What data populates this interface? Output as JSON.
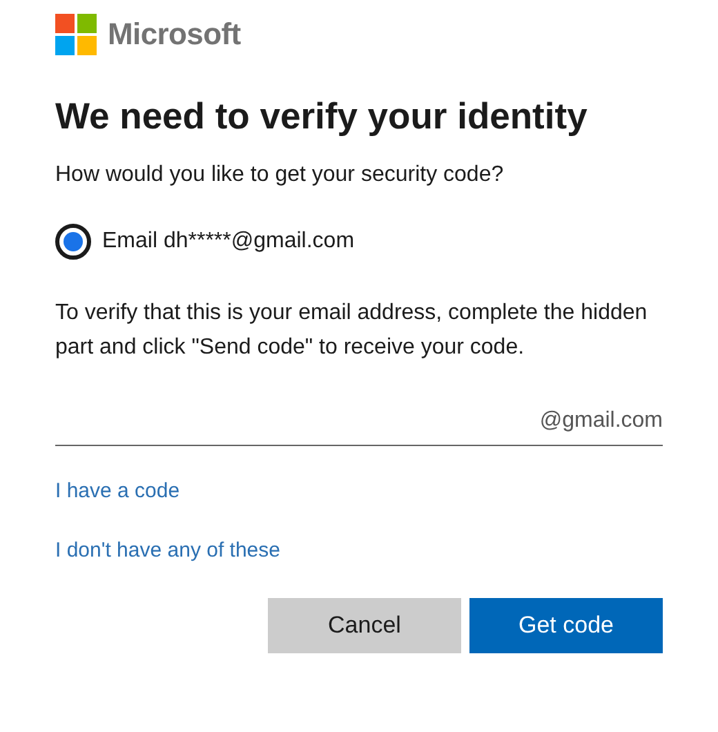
{
  "brand": {
    "name": "Microsoft"
  },
  "title": "We need to verify your identity",
  "question": "How would you like to get your security code?",
  "options": [
    {
      "label": "Email dh*****@gmail.com",
      "selected": true
    }
  ],
  "instructions": "To verify that this is your email address, complete the hidden part and click \"Send code\" to receive your code.",
  "email_field": {
    "suffix": "@gmail.com"
  },
  "links": [
    "I have a code",
    "I don't have any of these"
  ],
  "buttons": [
    {
      "label": "Cancel",
      "kind": "secondary"
    },
    {
      "label": "Get code",
      "kind": "primary"
    }
  ]
}
